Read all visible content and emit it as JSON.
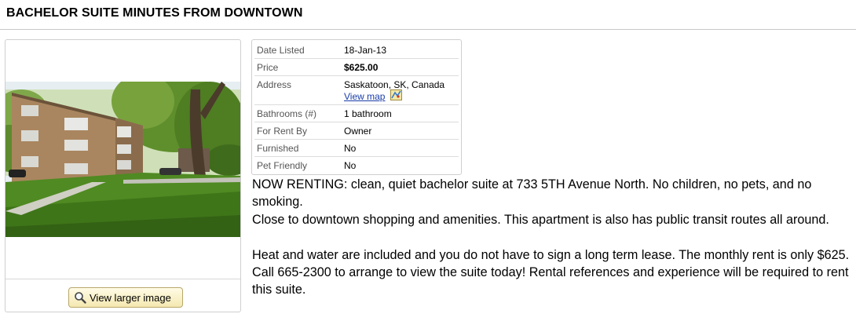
{
  "listing": {
    "title": "BACHELOR SUITE MINUTES FROM DOWNTOWN",
    "view_larger_label": "View larger image"
  },
  "details": {
    "date_listed": {
      "label": "Date Listed",
      "value": "18-Jan-13"
    },
    "price": {
      "label": "Price",
      "value": "$625.00"
    },
    "address": {
      "label": "Address",
      "value": "Saskatoon, SK, Canada",
      "map_link": "View map"
    },
    "bathrooms": {
      "label": "Bathrooms (#)",
      "value": "1 bathroom"
    },
    "for_rent_by": {
      "label": "For Rent By",
      "value": "Owner"
    },
    "furnished": {
      "label": "Furnished",
      "value": "No"
    },
    "pet_friendly": {
      "label": "Pet Friendly",
      "value": "No"
    }
  },
  "description": {
    "p1": "NOW RENTING: clean, quiet bachelor suite at 733 5TH Avenue North. No children, no pets, and no smoking.",
    "p2": "Close to downtown shopping and amenities. This apartment is also has public transit routes all around.",
    "p3": "Heat and water are included and you do not have to sign a long term lease. The monthly rent is only $625. Call 665-2300 to arrange to view the suite today! Rental references and experience will be required to rent this suite."
  },
  "icons": {
    "magnifier": "magnifier-icon",
    "map": "map-icon"
  }
}
